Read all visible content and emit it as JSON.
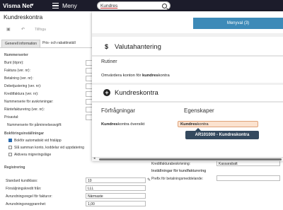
{
  "topbar": {
    "brand": "Visma Net",
    "menu_label": "Meny",
    "search_value": "Kundres"
  },
  "page": {
    "title": "Kundreskontra",
    "toolbar_disabled": "Tillfoga",
    "tabs": [
      "Generell information",
      "Pris- och rabattinställ"
    ],
    "sections": {
      "numberserier": "Nummerserier",
      "bokforing": "Bokföringsinställningar",
      "registrering": "Registrering"
    },
    "fields": [
      "Bunt (löpnr):",
      "Faktura (ver. nr):",
      "Betalning (ver. nr):",
      "Debetjustering (ver. nr):",
      "Kreditfaktura (ver. nr):",
      "Nummerserie för avskrivningar:",
      "Räntefakturering (ver. nr):",
      "Prisavtal:",
      "Nummerserie för påminnelseavgift:"
    ],
    "checkboxes": [
      "Bokför automatiskt vid frisläpp",
      "Slå samman konto, koddelar vid uppdatering",
      "Aktivera migreringsläge"
    ],
    "registrering_fields": [
      {
        "label": "Standard kundklass:",
        "value": "10"
      },
      {
        "label": "Försäljningskredit från:",
        "value": "LLL"
      },
      {
        "label": "Avrundningsregel för fakturor:",
        "value": "Närmaste"
      },
      {
        "label": "Avrundningsnoggrannhet:",
        "value": "1,00"
      }
    ],
    "right_fields": [
      "Kreditfakturabeskrivning:",
      "Inställningar för kundfakturering",
      "Prefix för betalningsmeddelande:"
    ],
    "right_value": "Kassarabatt"
  },
  "overlay": {
    "menuval_button": "Menyval (3)",
    "valuta_title": "Valutahantering",
    "rutiner_heading": "Rutiner",
    "rutiner_link_pre": "Omvärdera konton för ",
    "rutiner_link_bold": "kundres",
    "rutiner_link_post": "kontra",
    "kund_title": "Kundreskontra",
    "forfragningar_heading": "Förfrågningar",
    "egenskaper_heading": "Egenskaper",
    "oversikt_bold": "Kundres",
    "oversikt_rest": "kontra översikt",
    "tag_bold": "Kundres",
    "tag_rest": "kontra",
    "tooltip": "AR101000 - Kundreskontra"
  }
}
